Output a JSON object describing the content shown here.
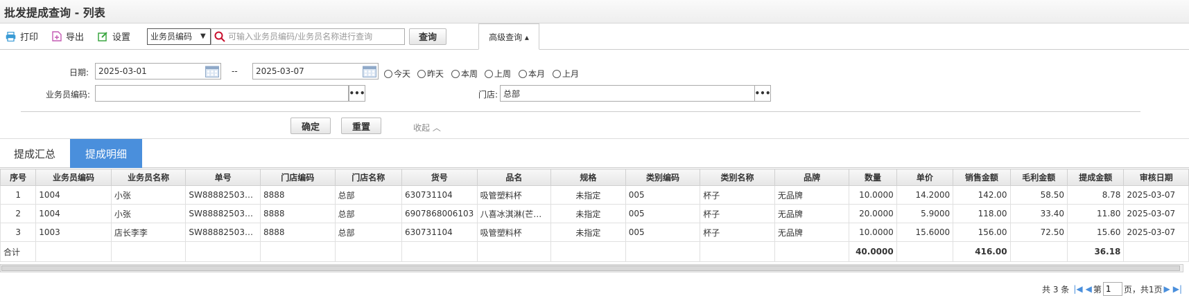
{
  "page": {
    "title": "批发提成查询 - 列表"
  },
  "toolbar": {
    "print_label": "打印",
    "export_label": "导出",
    "settings_label": "设置",
    "search_field_selected": "业务员编码",
    "search_placeholder": "可输入业务员编码/业务员名称进行查询",
    "query_label": "查询",
    "advanced_label": "高级查询 ▴"
  },
  "filter": {
    "date_label": "日期:",
    "date_from": "2025-03-01",
    "date_sep": "--",
    "date_to": "2025-03-07",
    "quick_ranges": [
      "今天",
      "昨天",
      "本周",
      "上周",
      "本月",
      "上月"
    ],
    "salesman_code_label": "业务员编码:",
    "salesman_code_value": "",
    "store_label": "门店:",
    "store_value": "总部",
    "confirm_label": "确定",
    "reset_label": "重置",
    "collapse_label": "收起 ︿"
  },
  "tabs": [
    {
      "label": "提成汇总",
      "active": false
    },
    {
      "label": "提成明细",
      "active": true
    }
  ],
  "table": {
    "columns": [
      "序号",
      "业务员编码",
      "业务员名称",
      "单号",
      "门店编码",
      "门店名称",
      "货号",
      "品名",
      "规格",
      "类别编码",
      "类别名称",
      "品牌",
      "数量",
      "单价",
      "销售金额",
      "毛利金额",
      "提成金额",
      "审核日期"
    ],
    "rows": [
      [
        "1",
        "1004",
        "小张",
        "SW888825030...",
        "8888",
        "总部",
        "630731104",
        "吸管塑料杯",
        "未指定",
        "005",
        "杯子",
        "无品牌",
        "10.0000",
        "14.2000",
        "142.00",
        "58.50",
        "8.78",
        "2025-03-07"
      ],
      [
        "2",
        "1004",
        "小张",
        "SW888825030...",
        "8888",
        "总部",
        "6907868006103",
        "八喜冰淇淋(芒果...",
        "未指定",
        "005",
        "杯子",
        "无品牌",
        "20.0000",
        "5.9000",
        "118.00",
        "33.40",
        "11.80",
        "2025-03-07"
      ],
      [
        "3",
        "1003",
        "店长李李",
        "SW888825030...",
        "8888",
        "总部",
        "630731104",
        "吸管塑料杯",
        "未指定",
        "005",
        "杯子",
        "无品牌",
        "10.0000",
        "15.6000",
        "156.00",
        "72.50",
        "15.60",
        "2025-03-07"
      ]
    ],
    "totals": {
      "label": "合计",
      "quantity": "40.0000",
      "sales": "416.00",
      "commission": "36.18"
    }
  },
  "pager": {
    "total_text": "共 3 条",
    "page_prefix": "第",
    "current_page": "1",
    "page_suffix": "页，共1页"
  },
  "colors": {
    "accent": "#4a8fdc",
    "print_icon": "#3a9bd5",
    "export_icon": "#c45ab3",
    "settings_icon": "#3aa640",
    "search_icon": "#c8102e"
  }
}
